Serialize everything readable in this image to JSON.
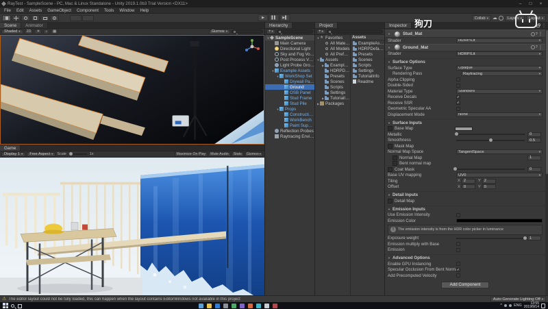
{
  "window": {
    "title": "RayTest - SampleScene - PC, Mac & Linux Standalone - Unity 2019.1.0b3 Trial Version <DX11>",
    "controls": {
      "minimize": "–",
      "maximize": "□",
      "close": "×"
    },
    "menus": [
      "File",
      "Edit",
      "Assets",
      "GameObject",
      "Component",
      "Tools",
      "Window",
      "Help"
    ]
  },
  "toolbar": {
    "collab": "Collab",
    "layers": "Layers",
    "layout": "Layout"
  },
  "watermark": {
    "text": "狗刀"
  },
  "scene": {
    "tabs": [
      "Scene",
      "Animator"
    ],
    "shaded": "Shaded",
    "btn_2d": "2D",
    "gizmos": "Gizmos"
  },
  "game": {
    "tab": "Game",
    "display": "Display 1",
    "aspect": "Free Aspect",
    "scale_label": "Scale",
    "scale_value": "1x",
    "buttons": [
      "Maximize On Play",
      "Mute Audio",
      "Stats",
      "Gizmos"
    ]
  },
  "hierarchy": {
    "tab": "Hierarchy",
    "create": "+",
    "items": [
      {
        "label": "SampleScene",
        "depth": 0,
        "icon": "unity",
        "arrow": "down",
        "header": true
      },
      {
        "label": "Main Camera",
        "depth": 1,
        "icon": "camera"
      },
      {
        "label": "Directional Light",
        "depth": 1,
        "icon": "light"
      },
      {
        "label": "Sky and Fog Volume",
        "depth": 1,
        "icon": "volume"
      },
      {
        "label": "Post Process Volume",
        "depth": 1,
        "icon": "volume"
      },
      {
        "label": "Light Probe Group",
        "depth": 1,
        "icon": "probe"
      },
      {
        "label": "Example Assets",
        "depth": 1,
        "icon": "prefab",
        "arrow": "down",
        "blue": true
      },
      {
        "label": "WorkShop Set",
        "depth": 2,
        "icon": "prefab",
        "arrow": "down",
        "blue": true
      },
      {
        "label": "Drywall Panel",
        "depth": 3,
        "icon": "prefab",
        "blue": true
      },
      {
        "label": "Ground",
        "depth": 3,
        "icon": "prefab",
        "blue": true,
        "selected": true
      },
      {
        "label": "OSB Panel",
        "depth": 3,
        "icon": "prefab",
        "blue": true
      },
      {
        "label": "Stud Frame",
        "depth": 3,
        "icon": "prefab",
        "blue": true
      },
      {
        "label": "Stud Pile",
        "depth": 3,
        "icon": "prefab",
        "blue": true
      },
      {
        "label": "Props",
        "depth": 2,
        "icon": "prefab",
        "arrow": "down",
        "blue": true
      },
      {
        "label": "Construction Light",
        "depth": 3,
        "icon": "prefab",
        "blue": true
      },
      {
        "label": "WorkBench",
        "depth": 3,
        "icon": "prefab",
        "blue": true
      },
      {
        "label": "Paint Supplies",
        "depth": 3,
        "icon": "prefab",
        "blue": true
      },
      {
        "label": "Reflection Probes",
        "depth": 1,
        "icon": "probe"
      },
      {
        "label": "Raytracing Environment",
        "depth": 1,
        "icon": "cube"
      }
    ]
  },
  "project": {
    "tab": "Project",
    "create": "+",
    "pane_header": "Assets",
    "tree": [
      {
        "label": "Favorites",
        "depth": 0,
        "icon": "star",
        "arrow": "down"
      },
      {
        "label": "All Materials",
        "depth": 1,
        "icon": "search"
      },
      {
        "label": "All Models",
        "depth": 1,
        "icon": "search"
      },
      {
        "label": "All Prefabs",
        "depth": 1,
        "icon": "search"
      },
      {
        "label": "Assets",
        "depth": 0,
        "icon": "folder",
        "arrow": "down"
      },
      {
        "label": "ExampleAssets",
        "depth": 1,
        "icon": "folder",
        "arrow": "right"
      },
      {
        "label": "HDRPDefaultResources",
        "depth": 1,
        "icon": "folder"
      },
      {
        "label": "Presets",
        "depth": 1,
        "icon": "folder"
      },
      {
        "label": "Scenes",
        "depth": 1,
        "icon": "folder"
      },
      {
        "label": "Scripts",
        "depth": 1,
        "icon": "folder"
      },
      {
        "label": "Settings",
        "depth": 1,
        "icon": "folder"
      },
      {
        "label": "TutorialInfo",
        "depth": 1,
        "icon": "folder",
        "arrow": "right"
      },
      {
        "label": "Packages",
        "depth": 0,
        "icon": "package",
        "arrow": "right"
      }
    ],
    "files": [
      {
        "label": "ExampleAssets",
        "icon": "folder"
      },
      {
        "label": "HDRPDefaultResources",
        "icon": "folder"
      },
      {
        "label": "Presets",
        "icon": "folder"
      },
      {
        "label": "Scenes",
        "icon": "folder"
      },
      {
        "label": "Scripts",
        "icon": "folder"
      },
      {
        "label": "Settings",
        "icon": "folder"
      },
      {
        "label": "TutorialInfo",
        "icon": "folder"
      },
      {
        "label": "Readme",
        "icon": "doc"
      }
    ]
  },
  "inspector": {
    "tab": "Inspector",
    "rows": [
      {
        "type": "material",
        "name": "Stud_Mat"
      },
      {
        "type": "shader",
        "label": "Shader",
        "value": "HDRP/Lit"
      },
      {
        "type": "material",
        "name": "Ground_Mat"
      },
      {
        "type": "shader",
        "label": "Shader",
        "value": "HDRP/Lit"
      },
      {
        "type": "section",
        "label": "Surface Options"
      },
      {
        "type": "dd",
        "label": "Surface Type",
        "value": "Opaque"
      },
      {
        "type": "dd",
        "label": "Rendering Pass",
        "value": "Raytracing",
        "indent": 1
      },
      {
        "type": "check",
        "label": "Alpha Clipping",
        "checked": false
      },
      {
        "type": "check",
        "label": "Double-Sided",
        "checked": false
      },
      {
        "type": "dd",
        "label": "Material Type",
        "value": "Standard"
      },
      {
        "type": "check",
        "label": "Receive Decals",
        "checked": true
      },
      {
        "type": "check",
        "label": "Receive SSR",
        "checked": true
      },
      {
        "type": "check",
        "label": "Geometric Specular AA",
        "checked": false
      },
      {
        "type": "dd",
        "label": "Displacement Mode",
        "value": "None"
      },
      {
        "type": "section",
        "label": "Surface Inputs"
      },
      {
        "type": "tex",
        "label": "Base Map",
        "swatch": "#9e9e9e"
      },
      {
        "type": "slider",
        "label": "Metallic",
        "value": "0",
        "t": 0
      },
      {
        "type": "slider",
        "label": "Smoothness",
        "value": "0.5",
        "t": 0.5
      },
      {
        "type": "tex",
        "label": "Mask Map"
      },
      {
        "type": "dd",
        "label": "Normal Map Space",
        "value": "TangentSpace"
      },
      {
        "type": "tex",
        "label": "Normal Map",
        "value": "1",
        "indent": 1
      },
      {
        "type": "tex",
        "label": "Bent normal map",
        "indent": 1
      },
      {
        "type": "texslider",
        "label": "Coat Mask",
        "value": "0",
        "t": 0
      },
      {
        "type": "dd",
        "label": "Base UV mapping",
        "value": "UV0"
      },
      {
        "type": "vec2",
        "label": "Tiling",
        "xl": "X",
        "x": "2",
        "yl": "Y",
        "y": "2"
      },
      {
        "type": "vec2",
        "label": "Offset",
        "xl": "X",
        "x": "0",
        "yl": "Y",
        "y": "0"
      },
      {
        "type": "section",
        "label": "Detail Inputs"
      },
      {
        "type": "tex",
        "label": "Detail Map"
      },
      {
        "type": "section",
        "label": "Emission Inputs"
      },
      {
        "type": "check",
        "label": "Use Emission Intensity",
        "checked": false
      },
      {
        "type": "color",
        "label": "Emission Color",
        "swatch": "#000000"
      },
      {
        "type": "info",
        "text": "The emission intensity is from the HDR color picker in luminance"
      },
      {
        "type": "slider",
        "label": "Exposure weight",
        "value": "1",
        "t": 1
      },
      {
        "type": "check",
        "label": "Emission multiply with Base",
        "checked": false
      },
      {
        "type": "check",
        "label": "Emission",
        "checked": false
      },
      {
        "type": "section",
        "label": "Advanced Options"
      },
      {
        "type": "check",
        "label": "Enable GPU Instancing",
        "checked": false
      },
      {
        "type": "check",
        "label": "Specular Occlusion From Bent Normal",
        "checked": true
      },
      {
        "type": "check",
        "label": "Add Precomputed Velocity",
        "checked": false
      },
      {
        "type": "button",
        "label": "Add Component"
      }
    ]
  },
  "statusbar": {
    "message": "The editor layout could not be fully loaded, this can happen when the layout contains EditorWindows not available in this project",
    "lighting": "Auto Generate Lighting Off"
  },
  "taskbar": {
    "time": "13:55",
    "date": "2019/9/14",
    "lang": "ENG",
    "tray_expand": "^",
    "apps": [
      "#5a9fd4",
      "#e8c24a",
      "#2f7fd4",
      "#8a8f98",
      "#4aa96a",
      "#7e64c8",
      "#d4683f",
      "#3fb6c8",
      "#c8cdd4",
      "#b04a4a"
    ]
  }
}
